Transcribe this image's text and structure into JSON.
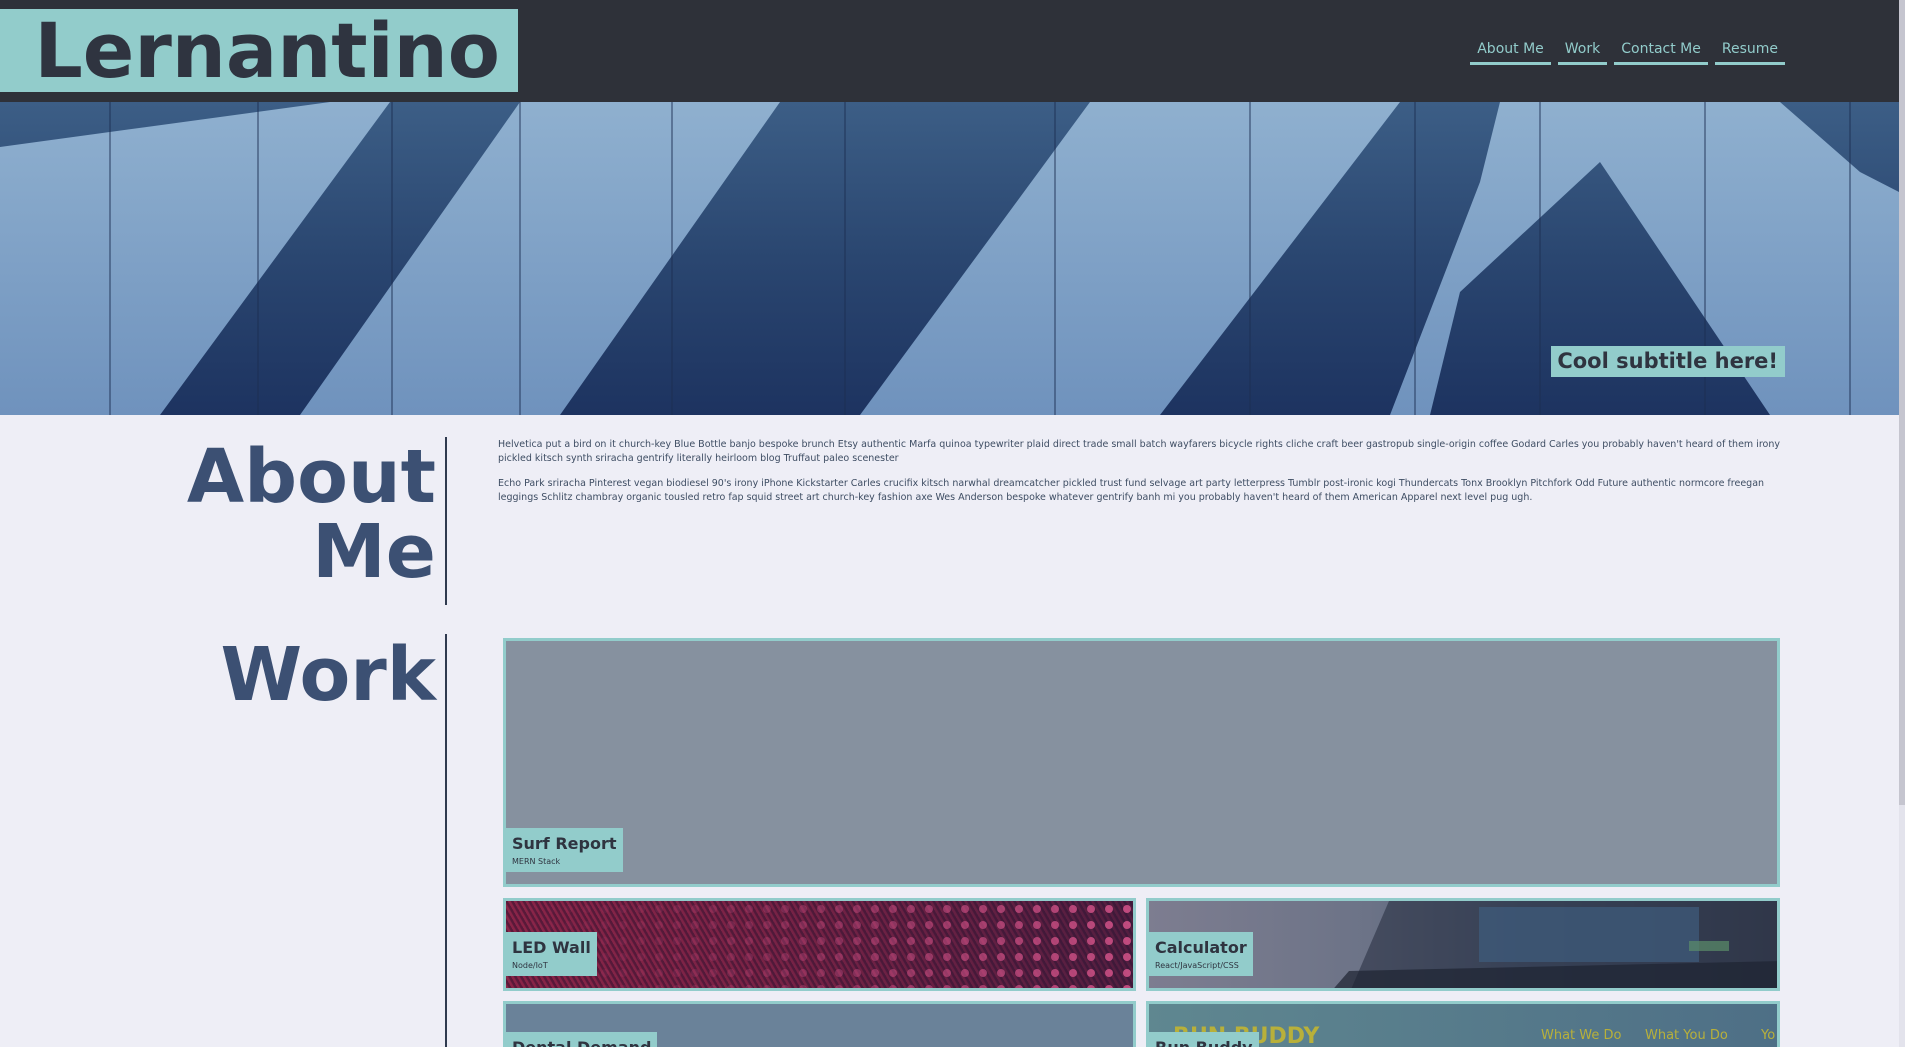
{
  "header": {
    "logo": "Lernantino",
    "nav": [
      "About Me",
      "Work",
      "Contact Me",
      "Resume"
    ]
  },
  "hero": {
    "subtitle": "Cool subtitle here!"
  },
  "about": {
    "title_line1": "About",
    "title_line2": "Me",
    "paragraphs": [
      "Helvetica put a bird on it church-key Blue Bottle banjo bespoke brunch Etsy authentic Marfa quinoa typewriter plaid direct trade small batch wayfarers bicycle rights cliche craft beer gastropub single-origin coffee Godard Carles you probably haven't heard of them irony pickled kitsch synth sriracha gentrify literally heirloom blog Truffaut paleo scenester",
      "Echo Park sriracha Pinterest vegan biodiesel 90's irony iPhone Kickstarter Carles crucifix kitsch narwhal dreamcatcher pickled trust fund selvage art party letterpress Tumblr post-ironic kogi Thundercats Tonx Brooklyn Pitchfork Odd Future authentic normcore freegan leggings Schlitz chambray organic tousled retro fap squid street art church-key fashion axe Wes Anderson bespoke whatever gentrify banh mi you probably haven't heard of them American Apparel next level pug ugh."
    ]
  },
  "work": {
    "title": "Work",
    "projects": [
      {
        "title": "Surf Report",
        "stack": "MERN Stack"
      },
      {
        "title": "LED Wall",
        "stack": "Node/IoT"
      },
      {
        "title": "Calculator",
        "stack": "React/JavaScript/CSS"
      },
      {
        "title": "Dental Demand",
        "stack": ""
      },
      {
        "title": "Run Buddy",
        "stack": ""
      }
    ],
    "runbuddy_preview": {
      "brand": "RUN BUDDY",
      "links": [
        "What We Do",
        "What You Do",
        "Yo"
      ]
    }
  },
  "colors": {
    "header_bg": "#2e3139",
    "accent": "#92cccb",
    "page_bg": "#eeeef6",
    "heading": "#3c5073"
  }
}
